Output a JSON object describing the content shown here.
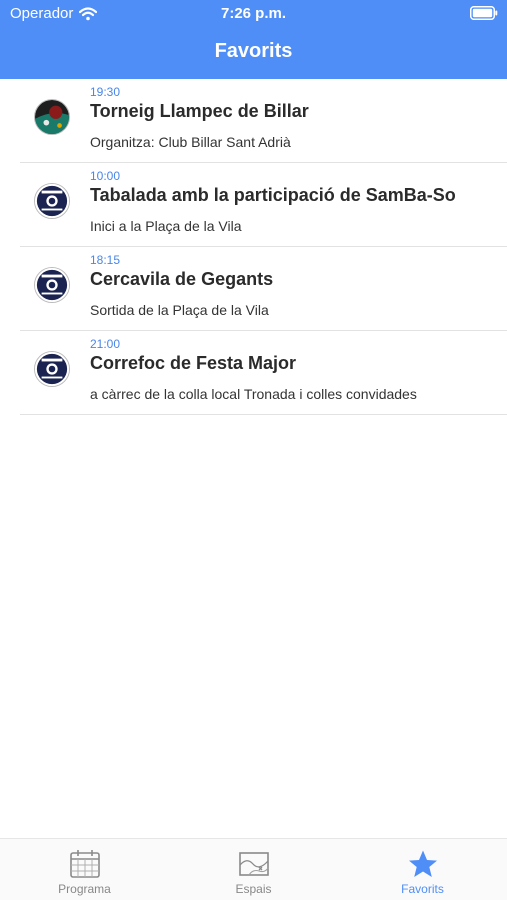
{
  "status_bar": {
    "carrier": "Operador",
    "time": "7:26 p.m."
  },
  "nav": {
    "title": "Favorits"
  },
  "favorites": [
    {
      "time": "19:30",
      "title": "Torneig Llampec de Billar",
      "subtitle": "Organitza: Club Billar Sant Adrià",
      "avatar": "billiards-photo"
    },
    {
      "time": "10:00",
      "title": "Tabalada amb la participació de SamBa-So",
      "subtitle": "Inici a la Plaça de la Vila",
      "avatar": "event-logo"
    },
    {
      "time": "18:15",
      "title": "Cercavila de Gegants",
      "subtitle": "Sortida de la Plaça de la Vila",
      "avatar": "event-logo"
    },
    {
      "time": "21:00",
      "title": "Correfoc de Festa Major",
      "subtitle": "a càrrec de la colla local Tronada i colles convidades",
      "avatar": "event-logo"
    }
  ],
  "tabs": [
    {
      "label": "Programa",
      "icon": "calendar-icon",
      "active": false
    },
    {
      "label": "Espais",
      "icon": "map-icon",
      "active": false
    },
    {
      "label": "Favorits",
      "icon": "star-icon",
      "active": true
    }
  ],
  "colors": {
    "accent": "#4f8ef7",
    "time_text": "#4a86e8",
    "inactive_tab": "#888888"
  }
}
